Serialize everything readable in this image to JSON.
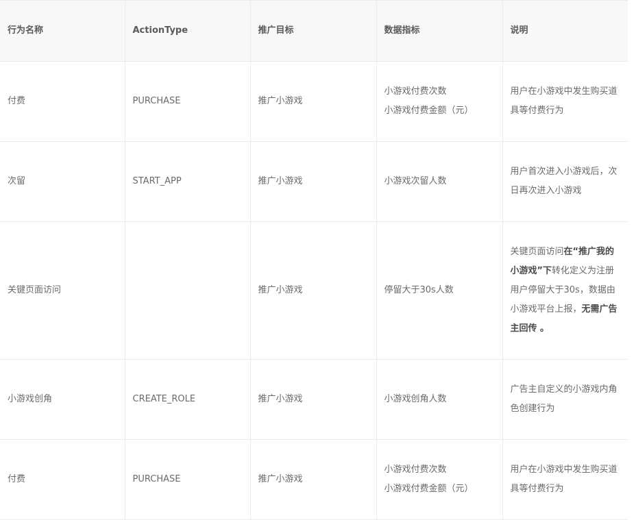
{
  "table": {
    "headers": [
      "行为名称",
      "ActionType",
      "推广目标",
      "数据指标",
      "说明"
    ],
    "rows": [
      {
        "name": "付费",
        "action_type": "PURCHASE",
        "goal": "推广小游戏",
        "metrics": [
          "小游戏付费次数",
          "小游戏付费金额（元）"
        ],
        "desc": "用户在小游戏中发生购买道具等付费行为"
      },
      {
        "name": "次留",
        "action_type": "START_APP",
        "goal": "推广小游戏",
        "metrics": [
          "小游戏次留人数"
        ],
        "desc": "用户首次进入小游戏后，次日再次进入小游戏"
      },
      {
        "name": "关键页面访问",
        "action_type": "",
        "goal": "推广小游戏",
        "metrics": [
          "停留大于30s人数"
        ],
        "desc_parts": {
          "p1": "关键页面访问",
          "p2_bold": "在“推广我的小游戏”下",
          "p3": "转化定义为注册用户停留大于30s，数据由小游戏平台上报，",
          "p4_bold": "无需广告主回传 。"
        }
      },
      {
        "name": "小游戏创角",
        "action_type": "CREATE_ROLE",
        "goal": "推广小游戏",
        "metrics": [
          "小游戏创角人数"
        ],
        "desc": "广告主自定义的小游戏内角色创建行为"
      },
      {
        "name": "付费",
        "action_type": "PURCHASE",
        "goal": "推广小游戏",
        "metrics": [
          "小游戏付费次数",
          "小游戏付费金额（元）"
        ],
        "desc": "用户在小游戏中发生购买道具等付费行为"
      }
    ]
  }
}
